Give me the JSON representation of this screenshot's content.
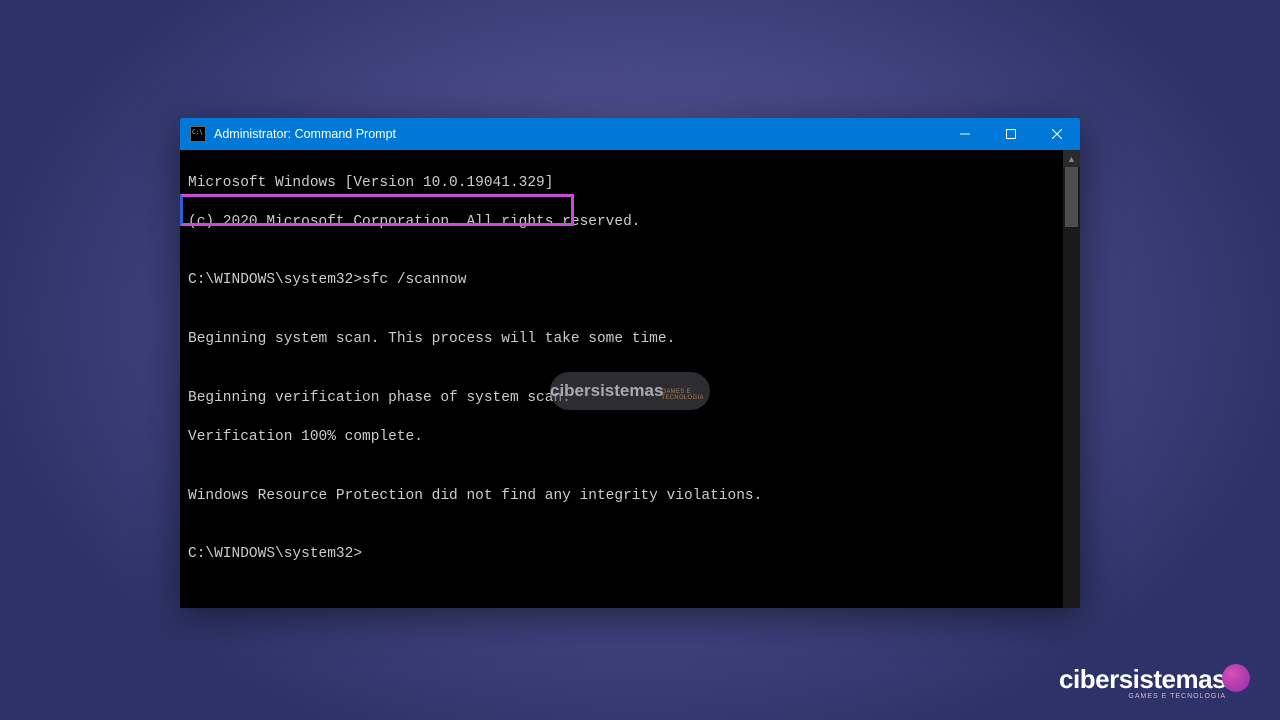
{
  "window": {
    "title": "Administrator: Command Prompt"
  },
  "terminal": {
    "line1": "Microsoft Windows [Version 10.0.19041.329]",
    "line2": "(c) 2020 Microsoft Corporation. All rights reserved.",
    "blank1": "",
    "prompt_cmd": "C:\\WINDOWS\\system32>sfc /scannow",
    "blank2": "",
    "line3": "Beginning system scan. This process will take some time.",
    "blank3": "",
    "line4": "Beginning verification phase of system scan.",
    "line5": "Verification 100% complete.",
    "blank4": "",
    "line6": "Windows Resource Protection did not find any integrity violations.",
    "blank5": "",
    "prompt2": "C:\\WINDOWS\\system32>"
  },
  "watermark": {
    "main": "cibersistemas",
    "sub": "GAMES E TECNOLOGIA"
  },
  "brand": {
    "main": "cibersistemas",
    "sub": "GAMES E TECNOLOGIA"
  }
}
